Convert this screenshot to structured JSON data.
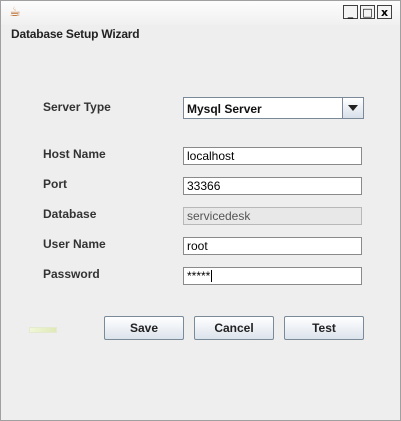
{
  "window": {
    "icon": "java-cup-icon",
    "controls": {
      "minimize": "_",
      "maximize": "□",
      "close": "x"
    }
  },
  "heading": "Database Setup Wizard",
  "form": {
    "server_type": {
      "label": "Server Type",
      "value": "Mysql Server"
    },
    "host_name": {
      "label": "Host Name",
      "value": "localhost"
    },
    "port": {
      "label": "Port",
      "value": "33366"
    },
    "database": {
      "label": "Database",
      "value": "servicedesk"
    },
    "user_name": {
      "label": "User Name",
      "value": "root"
    },
    "password": {
      "label": "Password",
      "value": "*****"
    }
  },
  "buttons": {
    "save": "Save",
    "cancel": "Cancel",
    "test": "Test"
  }
}
